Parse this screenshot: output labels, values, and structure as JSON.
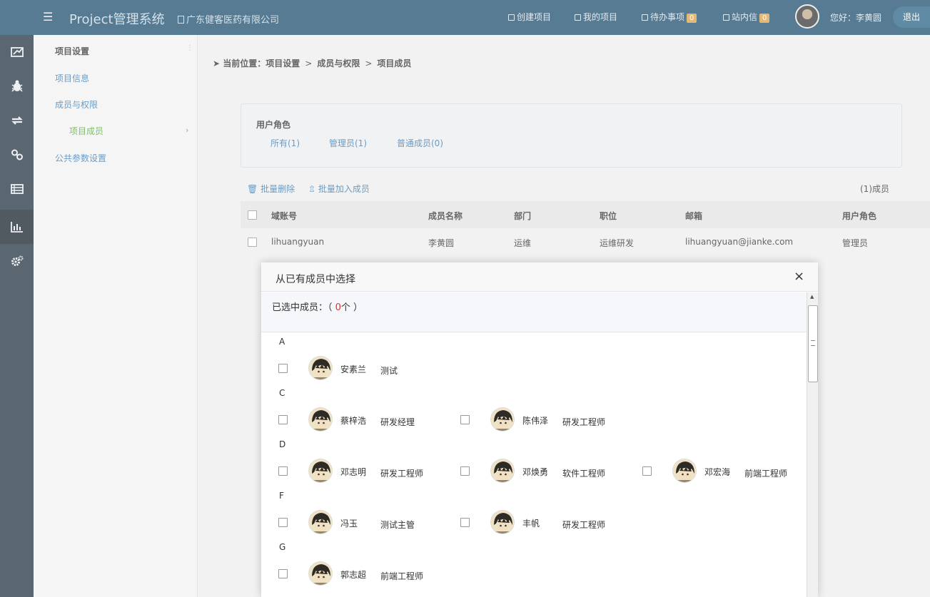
{
  "header": {
    "app_title": "Project管理系统",
    "company": "广东健客医药有限公司",
    "nav": [
      {
        "label": "创建项目"
      },
      {
        "label": "我的项目"
      },
      {
        "label": "待办事项",
        "badge": "0"
      },
      {
        "label": "站内信",
        "badge": "0"
      }
    ],
    "greeting": "您好：李黄圆",
    "logout": "退出"
  },
  "rail": {
    "items": [
      "dashboard-icon",
      "bug-icon",
      "transfer-icon",
      "link-icon",
      "list-icon",
      "chart-icon",
      "settings-icon"
    ],
    "active": "chart-icon"
  },
  "subnav": {
    "title": "项目设置",
    "items": [
      {
        "label": "项目信息"
      },
      {
        "label": "成员与权限"
      },
      {
        "label": "项目成员"
      },
      {
        "label": "公共参数设置"
      }
    ]
  },
  "breadcrumb": {
    "prefix": "当前位置：",
    "parts": [
      "项目设置",
      "成员与权限",
      "项目成员"
    ],
    "separator": ">"
  },
  "roles": {
    "title": "用户角色",
    "tabs": [
      {
        "label": "所有(1)"
      },
      {
        "label": "管理员(1)"
      },
      {
        "label": "普通成员(0)"
      }
    ]
  },
  "actions": {
    "batch_delete": "批量删除",
    "batch_add": "批量加入成员",
    "count": "(1)成员"
  },
  "table": {
    "headers": [
      "域账号",
      "成员名称",
      "部门",
      "职位",
      "邮箱",
      "用户角色"
    ],
    "rows": [
      [
        "lihuangyuan",
        "李黄圆",
        "运维",
        "运维研发",
        "lihuangyuan@jianke.com",
        "管理员"
      ]
    ]
  },
  "modal": {
    "title": "从已有成员中选择",
    "close": "×",
    "selected_prefix": "已选中成员：（ ",
    "selected_count": "0",
    "selected_suffix": "个 ）",
    "groups": [
      {
        "letter": "A",
        "members": [
          {
            "name": "安素兰",
            "job": "测试"
          }
        ]
      },
      {
        "letter": "C",
        "members": [
          {
            "name": "蔡梓浩",
            "job": "研发经理"
          },
          {
            "name": "陈伟泽",
            "job": "研发工程师"
          }
        ]
      },
      {
        "letter": "D",
        "members": [
          {
            "name": "邓志明",
            "job": "研发工程师"
          },
          {
            "name": "邓焕勇",
            "job": "软件工程师"
          },
          {
            "name": "邓宏海",
            "job": "前端工程师"
          }
        ]
      },
      {
        "letter": "F",
        "members": [
          {
            "name": "冯玉",
            "job": "测试主管"
          },
          {
            "name": "丰帆",
            "job": "研发工程师"
          }
        ]
      },
      {
        "letter": "G",
        "members": [
          {
            "name": "郭志超",
            "job": "前端工程师"
          }
        ]
      }
    ]
  }
}
